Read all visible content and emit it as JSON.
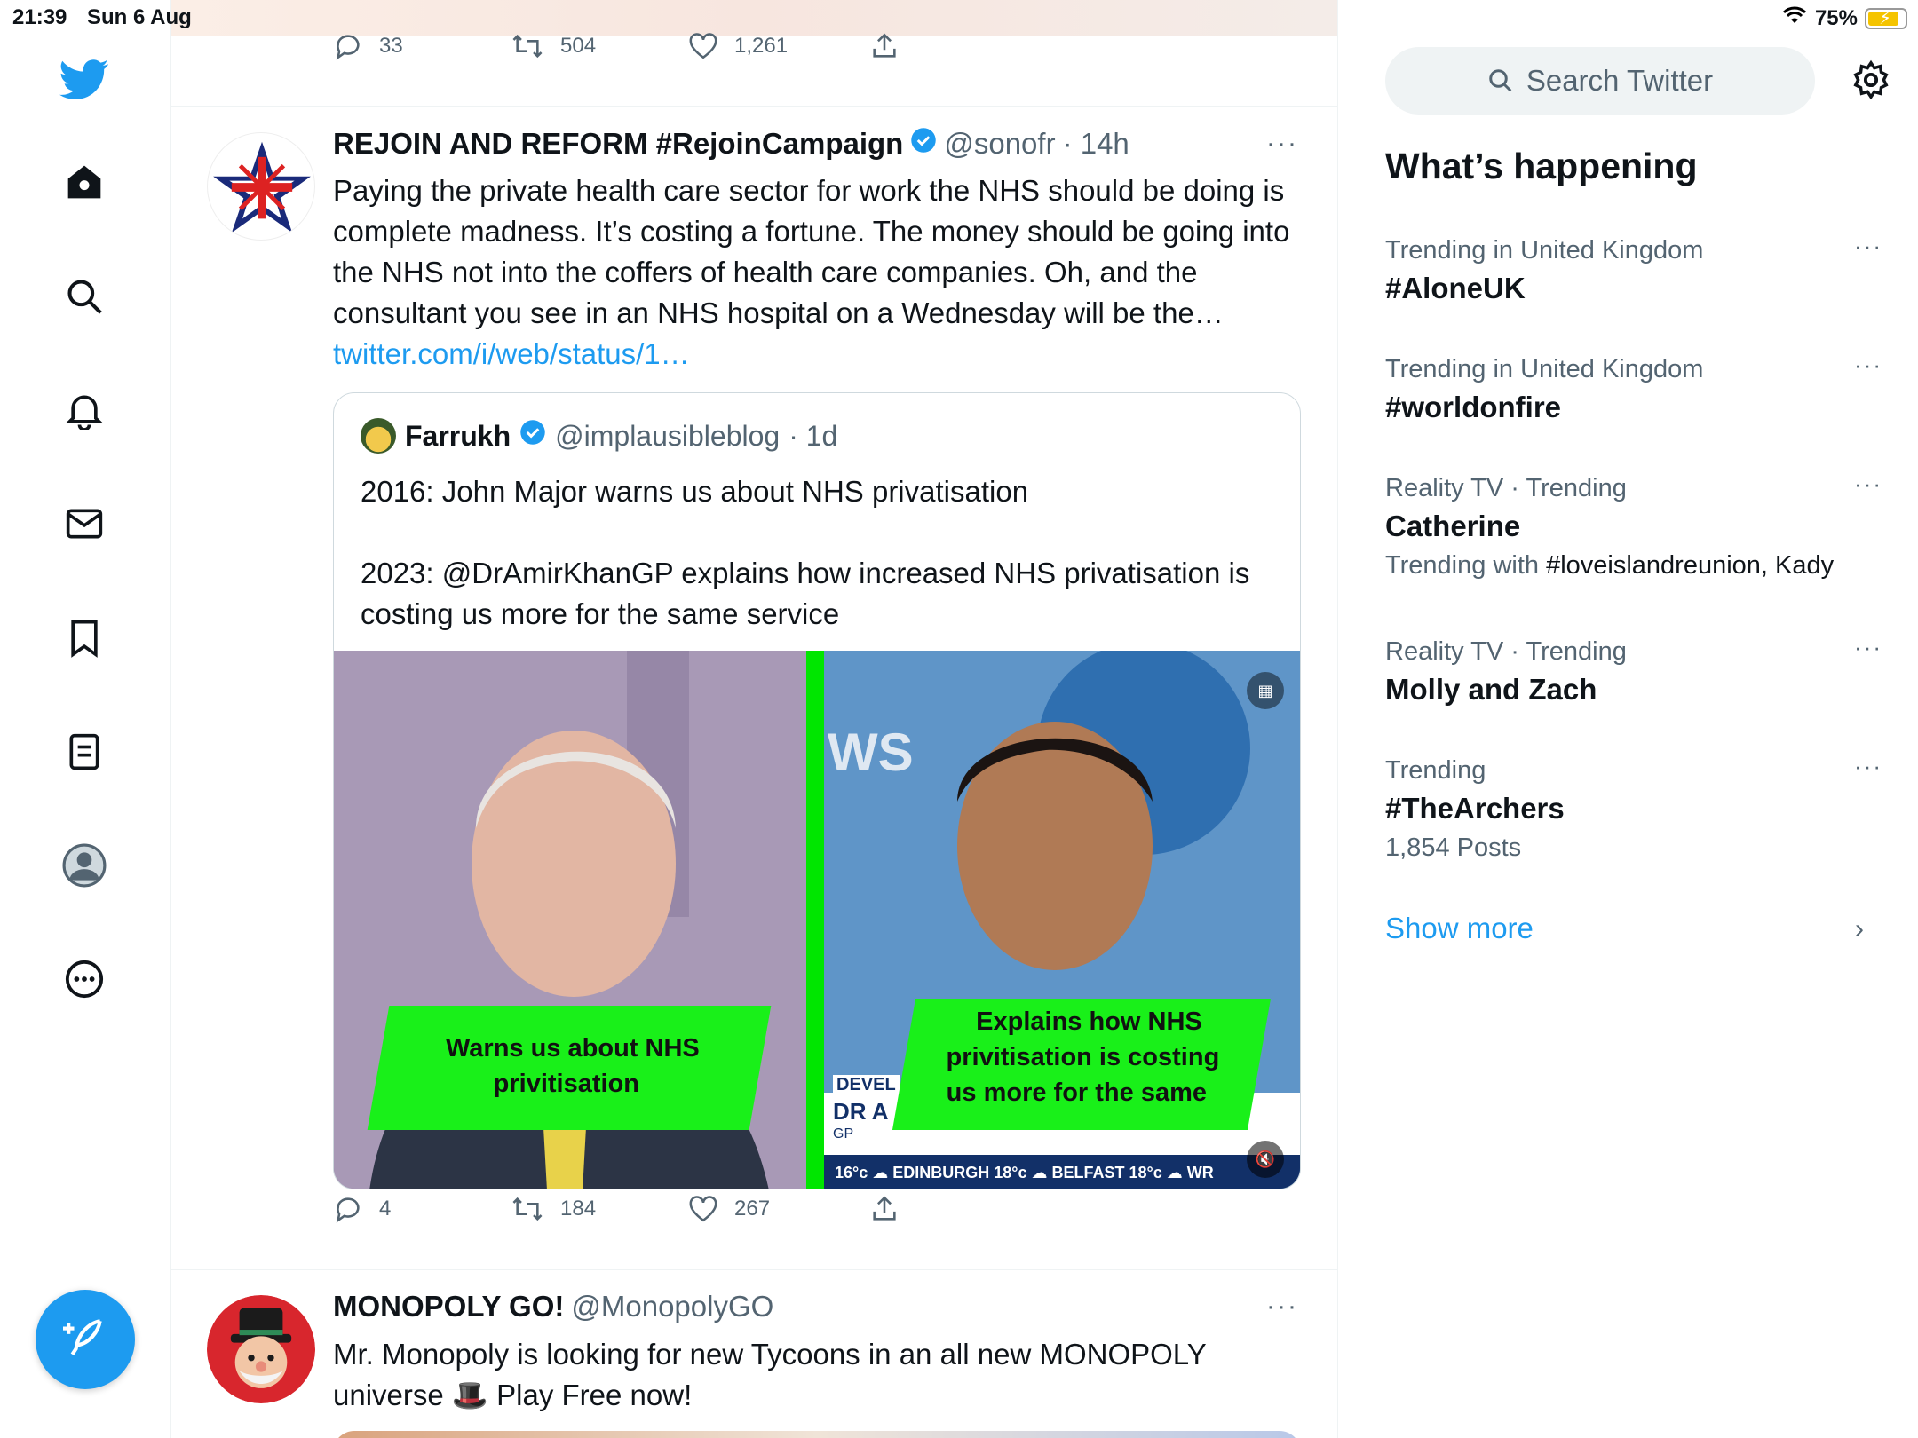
{
  "status_bar": {
    "time": "21:39",
    "date": "Sun 6 Aug",
    "battery": "75%"
  },
  "colors": {
    "accent": "#1d9bf0",
    "text": "#0f1419",
    "muted": "#536471",
    "green": "#19f019"
  },
  "nav": {
    "items": [
      "twitter-logo-icon",
      "home-icon",
      "search-icon",
      "notifications-icon",
      "messages-icon",
      "bookmarks-icon",
      "lists-icon",
      "profile-icon",
      "more-icon"
    ],
    "compose_icon": "compose-tweet-icon"
  },
  "prev_tweet_actions": {
    "replies": "33",
    "retweets": "504",
    "likes": "1,261"
  },
  "tweet1": {
    "name": "REJOIN AND REFORM #RejoinCampaign",
    "handle": "@sonofr",
    "time": "· 14h",
    "text": "Paying the private health care sector for work the NHS should be doing is complete madness. It’s costing a fortune. The money should be going into the NHS not into the coffers of health care companies. Oh, and the consultant you see in an NHS hospital on a Wednesday will be the…",
    "link": "twitter.com/i/web/status/1…",
    "quote": {
      "name": "Farrukh",
      "handle": "@implausibleblog",
      "time": "· 1d",
      "line1": "2016: John Major warns us about NHS privatisation",
      "line2": "2023: @DrAmirKhanGP explains how increased NHS privatisation is costing us more for the same service",
      "media": {
        "left_caption_1": "Warns us about NHS",
        "left_caption_2": "privitisation",
        "right_caption_1": "Explains how NHS",
        "right_caption_2": "privitisation is costing",
        "right_caption_3": "us more for the same",
        "channel_text": "WS",
        "lower_third_1": "DEVEL",
        "lower_third_2": "DR A",
        "lower_third_3": "GP",
        "ticker": "16°c  ☁ EDINBURGH 18°c  ☁ BELFAST 18°c  ☁ WR"
      }
    },
    "actions": {
      "replies": "4",
      "retweets": "184",
      "likes": "267"
    }
  },
  "tweet2": {
    "name": "MONOPOLY GO!",
    "handle": "@MonopolyGO",
    "text": "Mr. Monopoly is looking for new Tycoons in an all new MONOPOLY universe 🎩 Play Free now!"
  },
  "sidebar": {
    "search_placeholder": "Search Twitter",
    "title": "What’s happening",
    "trends": [
      {
        "meta": "Trending in United Kingdom",
        "topic": "#AloneUK",
        "extra": ""
      },
      {
        "meta": "Trending in United Kingdom",
        "topic": "#worldonfire",
        "extra": ""
      },
      {
        "meta": "Reality TV · Trending",
        "topic": "Catherine",
        "extra_prefix": "Trending with ",
        "extra": "#loveislandreunion, Kady"
      },
      {
        "meta": "Reality TV · Trending",
        "topic": "Molly and Zach",
        "extra": ""
      },
      {
        "meta": "Trending",
        "topic": "#TheArchers",
        "extra": "1,854 Posts"
      }
    ],
    "show_more": "Show more"
  }
}
